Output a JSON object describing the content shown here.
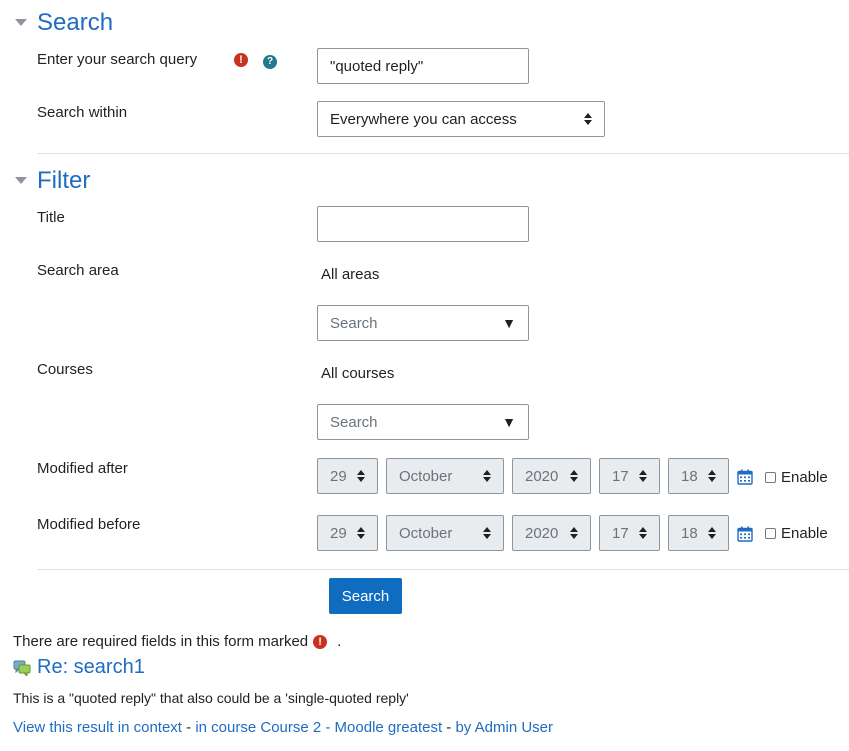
{
  "search_section": {
    "title": "Search",
    "query_label": "Enter your search query",
    "query_value": "\"quoted reply\"",
    "within_label": "Search within",
    "within_value": "Everywhere you can access",
    "required_icon": "exclamation-circle-icon",
    "help_icon": "question-circle-icon"
  },
  "filter_section": {
    "title": "Filter",
    "title_label": "Title",
    "title_value": "",
    "area_label": "Search area",
    "area_selected": "All areas",
    "area_search_placeholder": "Search",
    "courses_label": "Courses",
    "courses_selected": "All courses",
    "courses_search_placeholder": "Search",
    "modified_after": {
      "label": "Modified after",
      "day": "29",
      "month": "October",
      "year": "2020",
      "hour": "17",
      "minute": "18",
      "enable_label": "Enable",
      "enabled": false
    },
    "modified_before": {
      "label": "Modified before",
      "day": "29",
      "month": "October",
      "year": "2020",
      "hour": "17",
      "minute": "18",
      "enable_label": "Enable",
      "enabled": false
    }
  },
  "submit_label": "Search",
  "required_note_pre": "There are required fields in this form marked",
  "required_note_post": ".",
  "result": {
    "title": "Re: search1",
    "icon": "forum-discussion-icon",
    "snippet": "This is a \"quoted reply\" that also could be a 'single-quoted reply'",
    "context_link": "View this result in context",
    "sep1": " - ",
    "course_link": "in course Course 2 - Moodle greatest",
    "sep2": " - ",
    "author_link": "by Admin User"
  },
  "colors": {
    "accent": "#1f6cc1",
    "button": "#0f6cbf",
    "error": "#ca3120",
    "help": "#1f7a8c"
  }
}
